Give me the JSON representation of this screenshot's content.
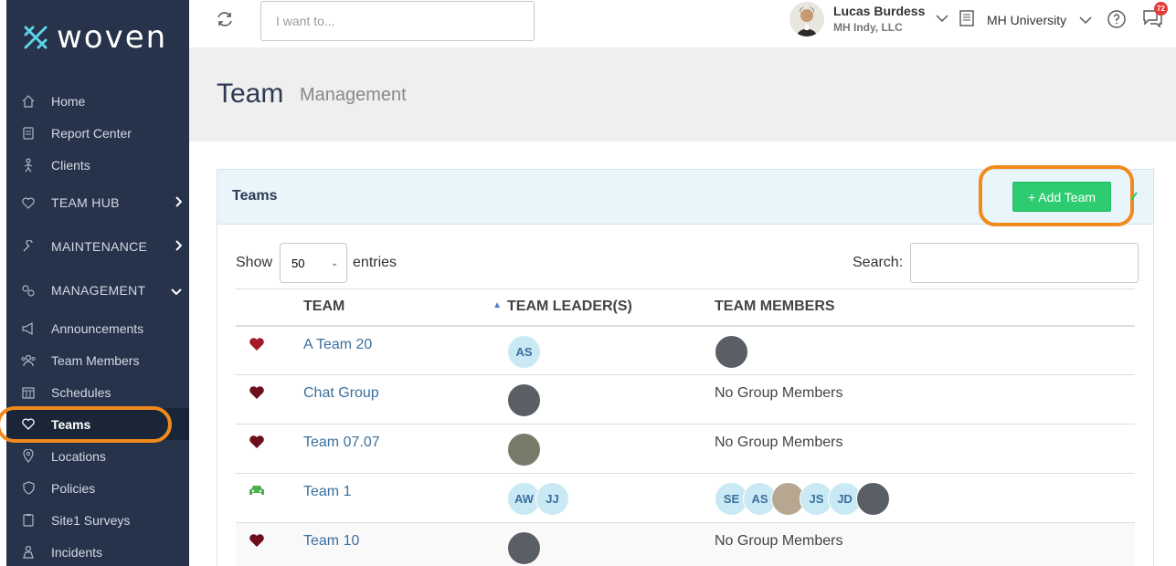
{
  "brand": {
    "name": "woven"
  },
  "sidebar": {
    "items": [
      {
        "label": "Home",
        "icon": "home-icon"
      },
      {
        "label": "Report Center",
        "icon": "report-icon"
      },
      {
        "label": "Clients",
        "icon": "clients-icon"
      }
    ],
    "sections": [
      {
        "label": "TEAM HUB",
        "icon": "heart-icon",
        "state": "collapsed"
      },
      {
        "label": "MAINTENANCE",
        "icon": "wrench-icon",
        "state": "collapsed"
      },
      {
        "label": "MANAGEMENT",
        "icon": "gears-icon",
        "state": "expanded"
      }
    ],
    "sub_items": [
      {
        "label": "Announcements",
        "icon": "megaphone-icon"
      },
      {
        "label": "Team Members",
        "icon": "people-icon"
      },
      {
        "label": "Schedules",
        "icon": "calendar-icon"
      },
      {
        "label": "Teams",
        "icon": "heart-icon",
        "active": true
      },
      {
        "label": "Locations",
        "icon": "location-pin-icon"
      },
      {
        "label": "Policies",
        "icon": "shield-icon"
      },
      {
        "label": "Site1 Surveys",
        "icon": "clipboard-icon"
      },
      {
        "label": "Incidents",
        "icon": "incident-icon"
      }
    ]
  },
  "topbar": {
    "search_placeholder": "I want to...",
    "user_name": "Lucas Burdess",
    "company": "MH Indy, LLC",
    "university": "MH University",
    "notification_count": "72"
  },
  "page": {
    "title": "Team",
    "subtitle": "Management"
  },
  "panel": {
    "title": "Teams",
    "add_label": "+ Add Team",
    "show_label": "Show",
    "entries_label": "entries",
    "page_size": "50",
    "search_label": "Search:"
  },
  "table": {
    "headers": [
      "TEAM",
      "TEAM LEADER(S)",
      "TEAM MEMBERS"
    ],
    "rows": [
      {
        "icon": "heart-icon",
        "team": "A Team 20",
        "leaders": [
          "AS"
        ],
        "members": [
          "photo"
        ]
      },
      {
        "icon": "heart-icon",
        "team": "Chat Group",
        "leaders": [
          "photo"
        ],
        "members_text": "No Group Members"
      },
      {
        "icon": "heart-icon",
        "team": "Team 07.07",
        "leaders": [
          "photo"
        ],
        "members_text": "No Group Members"
      },
      {
        "icon": "car-icon",
        "team": "Team 1",
        "leaders": [
          "AW",
          "JJ"
        ],
        "members": [
          "SE",
          "AS",
          "photo",
          "JS",
          "JD",
          "photo"
        ]
      },
      {
        "icon": "heart-icon",
        "team": "Team 10",
        "leaders": [
          "photo"
        ],
        "members_text": "No Group Members"
      }
    ]
  },
  "colors": {
    "sidebar_bg": "#26334a",
    "accent_green": "#2ecc71",
    "highlight_orange": "#f08a1c",
    "heart_red": "#a3192a",
    "car_green": "#4caf50",
    "link_blue": "#3b6f9e"
  }
}
